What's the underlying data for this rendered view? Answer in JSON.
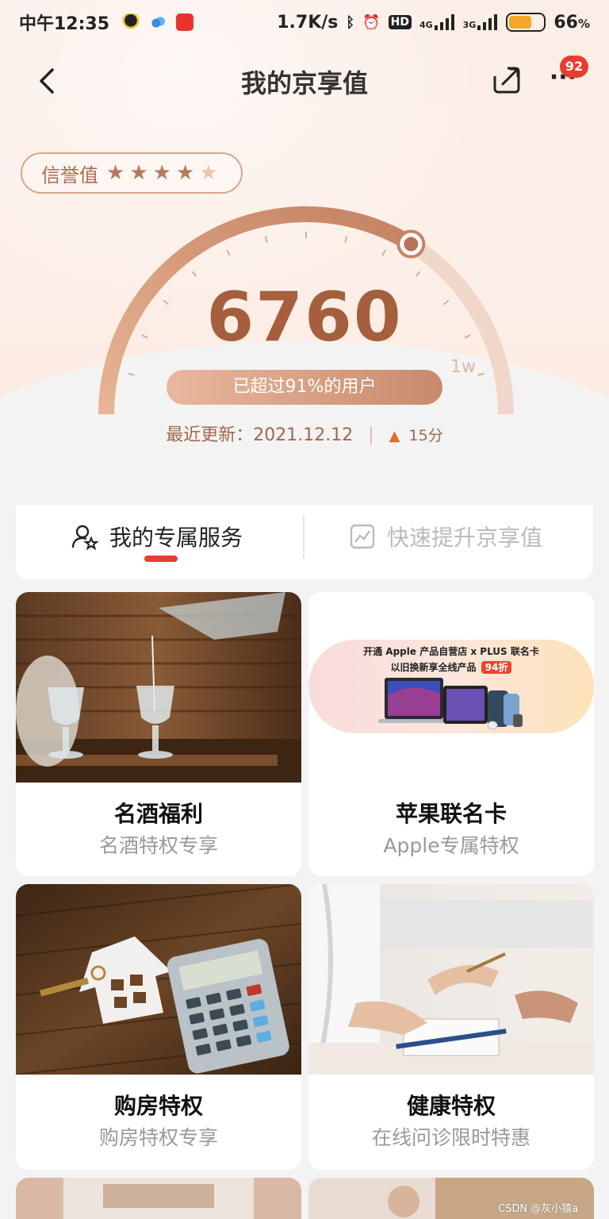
{
  "status_bar": {
    "time": "中午12:35",
    "net_speed": "1.7K/s",
    "hd_label": "HD",
    "sim1_label": "4G",
    "sim2_label": "3G",
    "battery_text": "66",
    "battery_unit": "%",
    "battery_level": 0.66
  },
  "nav": {
    "back_icon": "chevron-left-icon",
    "title": "我的京享值",
    "share_icon": "share-icon",
    "more_icon": "more-icon",
    "more_glyph": "···",
    "badge_count": "92"
  },
  "credit": {
    "label": "信誉值",
    "stars": 4.5,
    "max_stars": 5
  },
  "gauge": {
    "score": "6760",
    "value": 6760,
    "max": 10000,
    "max_label": "1w",
    "beat_text": "已超过91%的用户",
    "update_label": "最近更新：2021.12.12",
    "delta_text": "15分",
    "accent": "#c98766"
  },
  "tabs": [
    {
      "label": "我的专属服务",
      "icon": "user-star-icon",
      "active": true
    },
    {
      "label": "快速提升京享值",
      "icon": "chart-up-icon",
      "active": false
    }
  ],
  "cards": [
    {
      "title": "名酒福利",
      "subtitle": "名酒特权专享"
    },
    {
      "title": "苹果联名卡",
      "subtitle": "Apple专属特权",
      "banner_line1": "开通 Apple 产品自营店 x PLUS 联名卡",
      "banner_line2": "以旧换新享全线产品",
      "banner_tag": "94折"
    },
    {
      "title": "购房特权",
      "subtitle": "购房特权专享"
    },
    {
      "title": "健康特权",
      "subtitle": "在线问诊限时特惠"
    }
  ],
  "watermark": "CSDN @灰小猿a",
  "colors": {
    "brand_red": "#ea3c34",
    "gold_text": "#a55f3c"
  }
}
